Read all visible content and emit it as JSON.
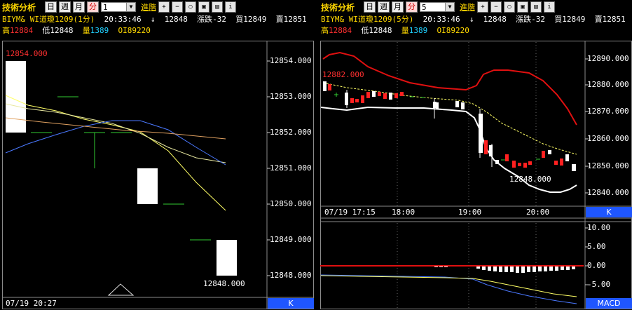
{
  "left": {
    "tool_title": "技術分析",
    "buttons": [
      "日",
      "週",
      "月",
      "分"
    ],
    "interval": "1",
    "advanced_link": "進階",
    "symbol": "BIYM& WI道瓊1209(1分)",
    "time": "20:33:46",
    "arrow": "↓",
    "last": "12848",
    "change_label": "漲跌-32",
    "bid_label": "買12849",
    "ask_label": "賣12851",
    "high_label": "高",
    "high": "12884",
    "low_label": "低12848",
    "vol_label": "量",
    "vol": "1389",
    "oi_label": "OI89220",
    "price_axis": [
      "12854.000",
      "12853.000",
      "12852.000",
      "12851.000",
      "12850.000",
      "12849.000",
      "12848.000"
    ],
    "max_label": "12854.000",
    "min_label": "12848.000",
    "date_label": "07/19 20:27",
    "k_label": "K"
  },
  "right": {
    "tool_title": "技術分析",
    "buttons": [
      "日",
      "週",
      "月",
      "分"
    ],
    "interval": "5",
    "advanced_link": "進階",
    "symbol": "BIYM& WI道瓊1209(5分)",
    "time": "20:33:46",
    "arrow": "↓",
    "last": "12848",
    "change_label": "漲跌-32",
    "bid_label": "買12849",
    "ask_label": "賣12851",
    "high_label": "高",
    "high": "12884",
    "low_label": "低12848",
    "vol_label": "量",
    "vol": "1389",
    "oi_label": "OI89220",
    "price_axis": [
      "12890.000",
      "12880.000",
      "12870.000",
      "12860.000",
      "12850.000",
      "12840.000"
    ],
    "max_label": "12882.000",
    "min_label": "12848.000",
    "time_axis": [
      "07/19 17:15",
      "18:00",
      "19:00",
      "20:00"
    ],
    "k_label": "K",
    "macd_axis": [
      "10.00",
      "5.00",
      "0.00",
      "-5.00"
    ],
    "macd_label": "MACD"
  },
  "colors": {
    "accent": "#ffd800",
    "up": "#ff2020",
    "down": "#ffffff",
    "axis_bg": "#1f56ff"
  },
  "icons": [
    "zoom-in-icon",
    "zoom-out-icon",
    "zoom-reset-icon",
    "print-icon",
    "export-icon",
    "info-icon"
  ]
}
